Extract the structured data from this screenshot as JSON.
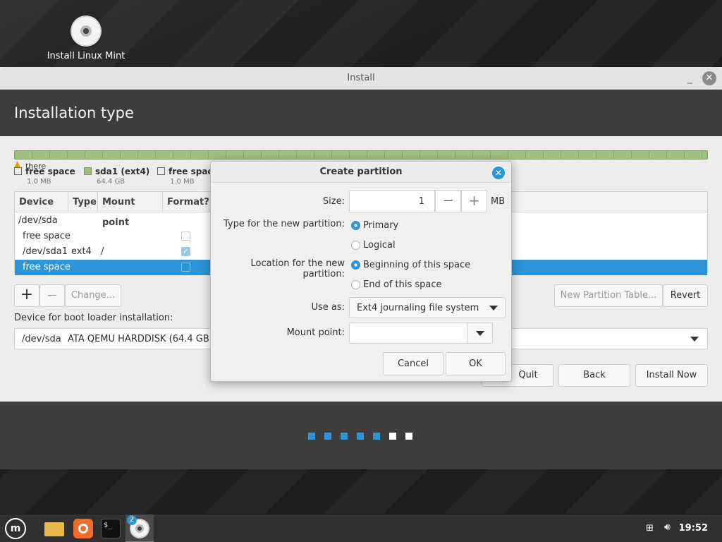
{
  "desktop": {
    "icon_label": "Install Linux Mint"
  },
  "window": {
    "title": "Install",
    "minimize_glyph": "_",
    "close_glyph": "✕",
    "heading": "Installation type"
  },
  "partition_bar": {
    "warning_text": "there",
    "legend": [
      {
        "name": "free space",
        "size": "1.0 MB",
        "color": "#ffffff"
      },
      {
        "name": "sda1 (ext4)",
        "size": "64.4 GB",
        "color": "#9fbf80"
      },
      {
        "name": "free spac",
        "size": "1.0 MB",
        "color": "#ffffff"
      }
    ]
  },
  "table": {
    "headers": [
      "Device",
      "Type",
      "Mount point",
      "Format?"
    ],
    "rows": [
      {
        "device": "/dev/sda",
        "type": "",
        "mount": ""
      },
      {
        "device": "free space",
        "type": "",
        "mount": ""
      },
      {
        "device": "/dev/sda1",
        "type": "ext4",
        "mount": "/"
      },
      {
        "device": "free space",
        "type": "",
        "mount": ""
      }
    ]
  },
  "toolbar": {
    "add_glyph": "+",
    "remove_glyph": "—",
    "change_label": "Change...",
    "new_table_label": "New Partition Table...",
    "revert_label": "Revert"
  },
  "bootloader": {
    "label": "Device for boot loader installation:",
    "device": "/dev/sda",
    "description": "ATA QEMU HARDDISK (64.4 GB)"
  },
  "nav": {
    "quit_label": "Quit",
    "back_label": "Back",
    "install_label": "Install Now"
  },
  "progress_dots": {
    "total": 7,
    "completed": 5,
    "active_color": "#2d96d8",
    "inactive_color": "#ffffff"
  },
  "dialog": {
    "title": "Create partition",
    "close_glyph": "✕",
    "size_label": "Size:",
    "size_value": "1",
    "size_unit": "MB",
    "minus_glyph": "—",
    "plus_glyph": "+",
    "type_label": "Type for the new partition:",
    "type_primary": "Primary",
    "type_logical": "Logical",
    "location_label": "Location for the new partition:",
    "location_beginning": "Beginning of this space",
    "location_end": "End of this space",
    "use_as_label": "Use as:",
    "use_as_value": "Ext4 journaling file system",
    "mount_label": "Mount point:",
    "mount_value": "",
    "cancel_label": "Cancel",
    "ok_label": "OK"
  },
  "taskbar": {
    "badge": "2",
    "clock": "19:52"
  }
}
